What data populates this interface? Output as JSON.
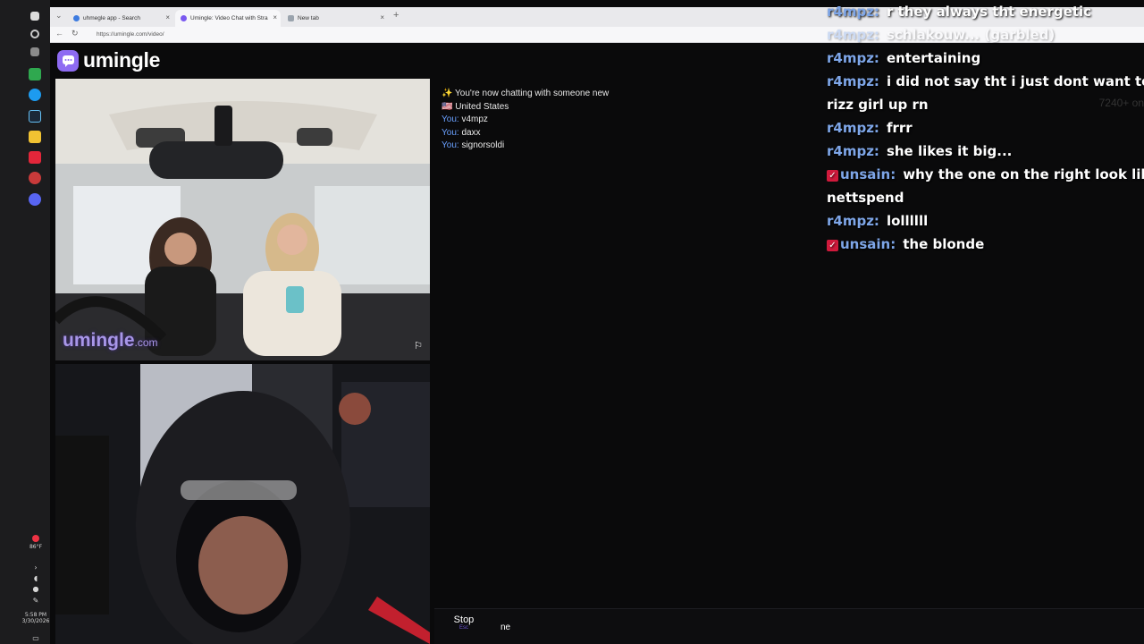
{
  "taskbar": {
    "weather": "86°F",
    "time": "5:58 PM",
    "date": "3/30/2026"
  },
  "browser": {
    "tabs": [
      {
        "title": "uhmegle app - Search",
        "color": "#3d7be0"
      },
      {
        "title": "Umingle: Video Chat with Stra",
        "color": "#7b5af0"
      },
      {
        "title": "New tab",
        "color": "#9aa3ad"
      }
    ],
    "url": "https://umingle.com/video/"
  },
  "site": {
    "logo_text": "umingle",
    "watermark_main": "umingle",
    "watermark_suffix": ".com",
    "online_count": "7240+ on"
  },
  "chat": {
    "system_line": "✨ You're now chatting with someone new",
    "country_flag": "🇺🇸",
    "country": "United States",
    "you_label": "You:",
    "messages": [
      "v4mpz",
      "daxx",
      "signorsoldi"
    ],
    "stop_label": "Stop",
    "stop_shortcut": "Esc",
    "input_value": "ne"
  },
  "overlay": {
    "lines": [
      {
        "user": "r4mpz:",
        "badge": false,
        "text": "r they always tht energetic"
      },
      {
        "user": "r4mpz:",
        "badge": false,
        "text": "schlakouw... (garbled)"
      },
      {
        "user": "r4mpz:",
        "badge": false,
        "text": "entertaining"
      },
      {
        "user": "r4mpz:",
        "badge": false,
        "text": "i did not say tht i just dont want to"
      },
      {
        "user": "",
        "badge": false,
        "text": "rizz girl up rn"
      },
      {
        "user": "r4mpz:",
        "badge": false,
        "text": "frrr"
      },
      {
        "user": "r4mpz:",
        "badge": false,
        "text": "she likes it big..."
      },
      {
        "user": "unsain:",
        "badge": true,
        "text": "why the one on the right look like"
      },
      {
        "user": "",
        "badge": false,
        "text": "nettspend"
      },
      {
        "user": "r4mpz:",
        "badge": false,
        "text": "lollllll"
      },
      {
        "user": "unsain:",
        "badge": true,
        "text": "the blonde"
      }
    ],
    "badge_glyph": "✓"
  }
}
